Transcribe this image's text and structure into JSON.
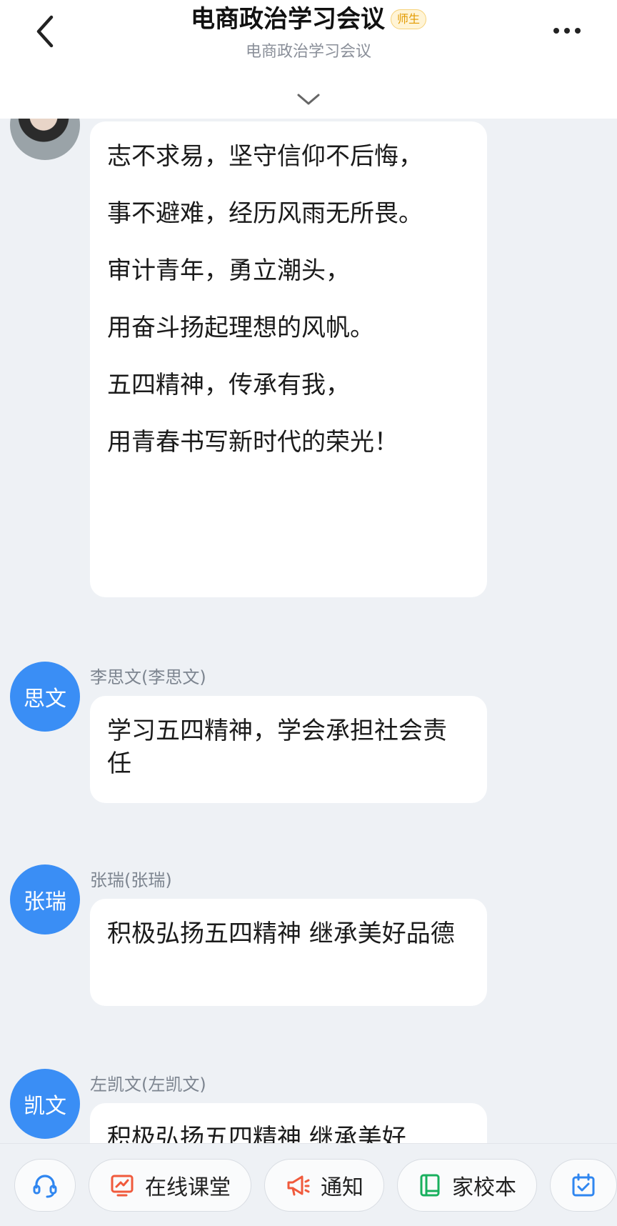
{
  "header": {
    "title": "电商政治学习会议",
    "badge": "师生",
    "subtitle": "电商政治学习会议"
  },
  "messages": [
    {
      "paragraphs": [
        "志不求易，坚守信仰不后悔，",
        "事不避难，经历风雨无所畏。",
        "审计青年，勇立潮头，",
        "用奋斗扬起理想的风帆。",
        "五四精神，传承有我，",
        "用青春书写新时代的荣光！"
      ]
    },
    {
      "sender": "李思文(李思文)",
      "avatar_text": "思文",
      "text": "学习五四精神，学会承担社会责任"
    },
    {
      "sender": "张瑞(张瑞)",
      "avatar_text": "张瑞",
      "text": "积极弘扬五四精神 继承美好品德"
    },
    {
      "sender": "左凯文(左凯文)",
      "avatar_text": "凯文",
      "text": "积极弘扬五四精神 继承美好"
    }
  ],
  "toolbar": {
    "items": [
      {
        "label": "在线课堂",
        "icon": "classroom-icon",
        "color": "#f05a3c"
      },
      {
        "label": "通知",
        "icon": "megaphone-icon",
        "color": "#f05a3c"
      },
      {
        "label": "家校本",
        "icon": "notebook-icon",
        "color": "#19b05e"
      }
    ]
  },
  "colors": {
    "accent": "#3a8ef5",
    "badge": "#e29a00",
    "background": "#eef1f5"
  }
}
